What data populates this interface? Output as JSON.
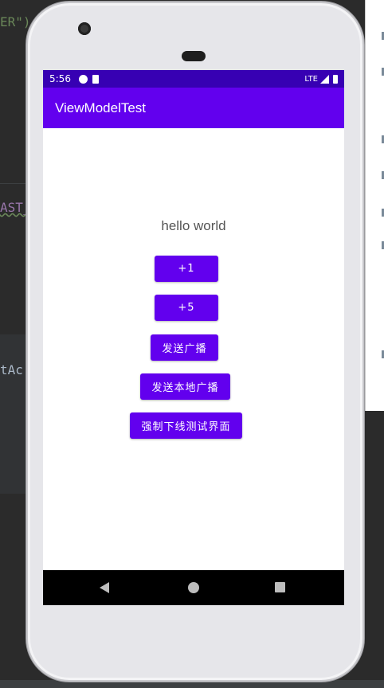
{
  "ide": {
    "frag_top": "ER\")",
    "frag_mid": "AST_",
    "frag_low": "tAc"
  },
  "status_bar": {
    "time": "5:56",
    "network": "LTE",
    "icons": [
      "notification-icon",
      "sd-card-icon",
      "signal-icon",
      "battery-icon"
    ]
  },
  "app_bar": {
    "title": "ViewModelTest"
  },
  "content": {
    "text": "hello world",
    "buttons": [
      {
        "label": "+1"
      },
      {
        "label": "+5"
      },
      {
        "label": "发送广播"
      },
      {
        "label": "发送本地广播"
      },
      {
        "label": "强制下线测试界面"
      }
    ]
  },
  "nav_bar": {
    "icons": [
      "back-icon",
      "home-icon",
      "recents-icon"
    ]
  },
  "colors": {
    "primary": "#6200ee",
    "primary_dark": "#3700b3",
    "nav_background": "#000000"
  }
}
